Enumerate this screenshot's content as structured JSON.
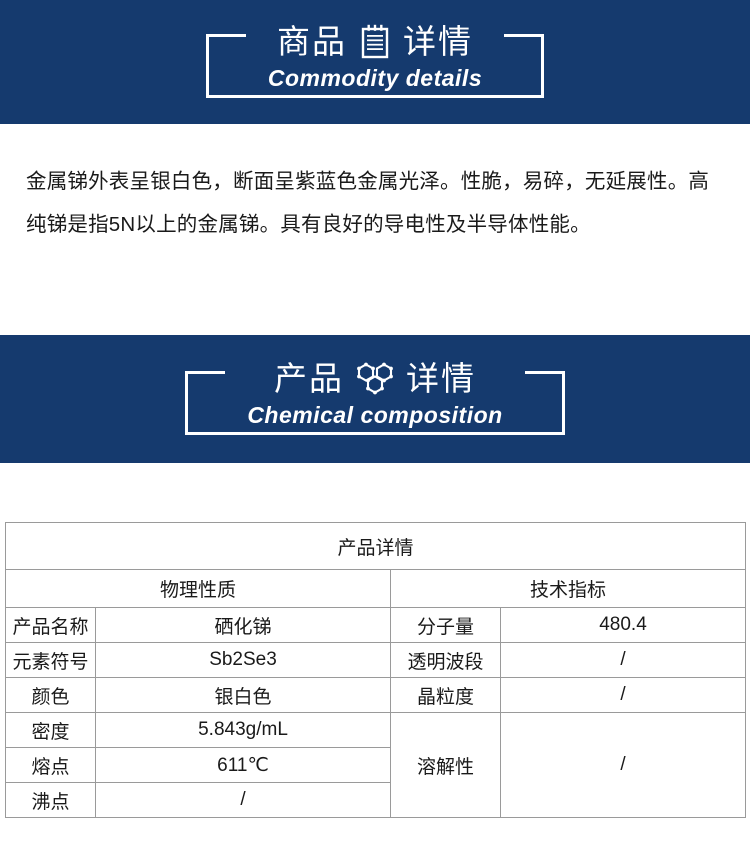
{
  "banners": [
    {
      "id": "commodity",
      "cn_left": "商品",
      "cn_right": "详情",
      "en": "Commodity details",
      "icon": "clipboard-icon",
      "bg_color": "#153a6e"
    },
    {
      "id": "chemical",
      "cn_left": "产品",
      "cn_right": "详情",
      "en": "Chemical composition",
      "icon": "molecule-hexagons-icon",
      "bg_color": "#153a6e"
    }
  ],
  "intro": {
    "paragraph": "金属锑外表呈银白色，断面呈紫蓝色金属光泽。性脆，易碎，无延展性。高纯锑是指5N以上的金属锑。具有良好的导电性及半导体性能。"
  },
  "spec_table": {
    "title": "产品详情",
    "group_headers": [
      "物理性质",
      "技术指标"
    ],
    "left_rows": [
      {
        "label": "产品名称",
        "value": "硒化锑"
      },
      {
        "label": "元素符号",
        "value": "Sb2Se3"
      },
      {
        "label": "颜色",
        "value": "银白色"
      },
      {
        "label": "密度",
        "value": "5.843g/mL"
      },
      {
        "label": "熔点",
        "value": "611℃"
      },
      {
        "label": "沸点",
        "value": "/"
      }
    ],
    "right_rows": [
      {
        "label": "分子量",
        "value": "480.4"
      },
      {
        "label": "透明波段",
        "value": "/"
      },
      {
        "label": "晶粒度",
        "value": "/"
      },
      {
        "label": "溶解性",
        "value": "/"
      }
    ]
  },
  "colors": {
    "banner_blue": "#153a6e",
    "table_border": "#9a9a9a",
    "text": "#1a1a1a",
    "banner_text": "#ffffff"
  }
}
